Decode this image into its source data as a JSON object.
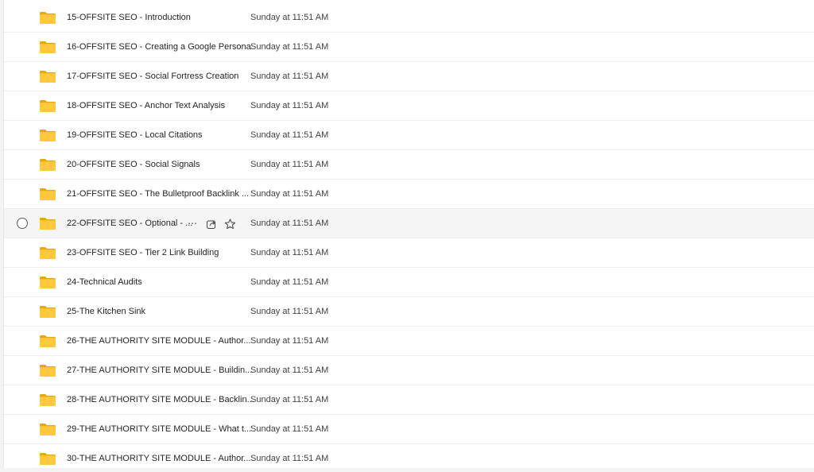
{
  "files": [
    {
      "name": "15-OFFSITE SEO - Introduction",
      "modified": "Sunday at 11:51 AM",
      "icon": "folder-icon"
    },
    {
      "name": "16-OFFSITE SEO - Creating a Google Persona",
      "modified": "Sunday at 11:51 AM",
      "icon": "folder-icon"
    },
    {
      "name": "17-OFFSITE SEO - Social Fortress Creation",
      "modified": "Sunday at 11:51 AM",
      "icon": "folder-icon"
    },
    {
      "name": "18-OFFSITE SEO - Anchor Text Analysis",
      "modified": "Sunday at 11:51 AM",
      "icon": "folder-icon"
    },
    {
      "name": "19-OFFSITE SEO - Local Citations",
      "modified": "Sunday at 11:51 AM",
      "icon": "folder-icon"
    },
    {
      "name": "20-OFFSITE SEO - Social Signals",
      "modified": "Sunday at 11:51 AM",
      "icon": "folder-icon"
    },
    {
      "name": "21-OFFSITE SEO - The Bulletproof Backlink ...",
      "modified": "Sunday at 11:51 AM",
      "icon": "folder-icon"
    },
    {
      "name": "22-OFFSITE SEO - Optional - ...",
      "modified": "Sunday at 11:51 AM",
      "icon": "folder-icon",
      "hovered": true,
      "more_label": "⋯"
    },
    {
      "name": "23-OFFSITE SEO - Tier 2 Link Building",
      "modified": "Sunday at 11:51 AM",
      "icon": "folder-icon"
    },
    {
      "name": "24-Technical Audits",
      "modified": "Sunday at 11:51 AM",
      "icon": "folder-icon"
    },
    {
      "name": "25-The Kitchen Sink",
      "modified": "Sunday at 11:51 AM",
      "icon": "folder-icon"
    },
    {
      "name": "26-THE AUTHORITY SITE MODULE - Author...",
      "modified": "Sunday at 11:51 AM",
      "icon": "folder-icon"
    },
    {
      "name": "27-THE AUTHORITY SITE MODULE - Buildin...",
      "modified": "Sunday at 11:51 AM",
      "icon": "folder-icon"
    },
    {
      "name": "28-THE AUTHORITY SITE MODULE - Backlin...",
      "modified": "Sunday at 11:51 AM",
      "icon": "folder-icon"
    },
    {
      "name": "29-THE AUTHORITY SITE MODULE - What t...",
      "modified": "Sunday at 11:51 AM",
      "icon": "folder-icon"
    },
    {
      "name": "30-THE AUTHORITY SITE MODULE - Author...",
      "modified": "Sunday at 11:51 AM",
      "icon": "folder-icon"
    }
  ],
  "colors": {
    "folder_front": "#FFC83D",
    "folder_back": "#E8A718",
    "row_hover": "#F5F5F5",
    "divider": "#EDEDED"
  }
}
